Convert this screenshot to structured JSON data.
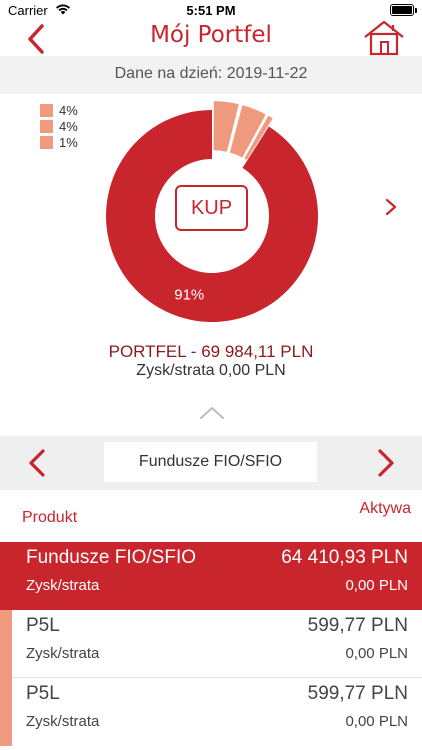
{
  "status": {
    "carrier": "Carrier",
    "time": "5:51 PM"
  },
  "nav": {
    "title": "Mój Portfel"
  },
  "date_line": "Dane na dzień: 2019-11-22",
  "chart_data": {
    "type": "pie",
    "variant": "donut",
    "slices": [
      {
        "label": "91%",
        "value": 91,
        "color": "#c8252c"
      },
      {
        "label": "4%",
        "value": 4,
        "color": "#ef9a7e"
      },
      {
        "label": "4%",
        "value": 4,
        "color": "#ef9a7e"
      },
      {
        "label": "1%",
        "value": 1,
        "color": "#ef9a7e"
      }
    ],
    "legend": [
      "4%",
      "4%",
      "1%"
    ],
    "legend_position": "top-left",
    "center_button": "KUP"
  },
  "portfel": {
    "title": "PORTFEL - 69 984,11 PLN",
    "zysk": "Zysk/strata 0,00 PLN"
  },
  "selector": {
    "category": "Fundusze FIO/SFIO"
  },
  "table": {
    "col_product": "Produkt",
    "col_assets": "Aktywa",
    "group": {
      "name": "Fundusze FIO/SFIO",
      "amount": "64 410,93 PLN",
      "zysk_label": "Zysk/strata",
      "zysk_value": "0,00 PLN"
    },
    "items": [
      {
        "name": "P5L",
        "amount": "599,77 PLN",
        "zysk_label": "Zysk/strata",
        "zysk_value": "0,00 PLN"
      },
      {
        "name": "P5L",
        "amount": "599,77 PLN",
        "zysk_label": "Zysk/strata",
        "zysk_value": "0,00 PLN"
      }
    ]
  },
  "colors": {
    "accent": "#c8252c",
    "accent_light": "#ef9a7e",
    "dark_red_text": "#8b1a1a"
  }
}
